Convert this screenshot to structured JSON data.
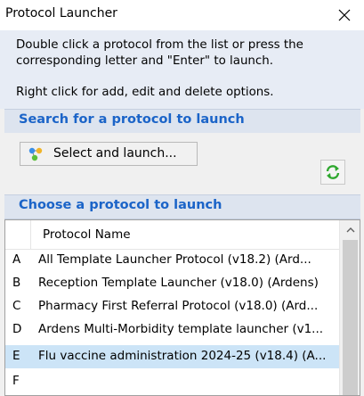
{
  "window": {
    "title": "Protocol Launcher",
    "close_icon": "close-icon"
  },
  "help": {
    "line1": "Double click a protocol from the list or press the",
    "line2": "corresponding letter and \"Enter\" to launch.",
    "line3": "Right click for add, edit and delete options."
  },
  "search_section": {
    "header": "Search for a protocol to launch",
    "button_label": "Select and launch...",
    "button_icon": "protocol-tree-icon",
    "refresh_icon": "refresh-icon"
  },
  "choose_section": {
    "header": "Choose a protocol to launch",
    "column_header": "Protocol Name",
    "rows": [
      {
        "key": "A",
        "name": "All Template Launcher Protocol (v18.2) (Ard...",
        "selected": false
      },
      {
        "key": "B",
        "name": "Reception Template Launcher (v18.0) (Ardens)",
        "selected": false
      },
      {
        "key": "C",
        "name": "Pharmacy First Referral Protocol (v18.0) (Ard...",
        "selected": false
      },
      {
        "key": "D",
        "name": "Ardens Multi-Morbidity template launcher (v1...",
        "selected": false
      },
      {
        "key": "E",
        "name": "Flu vaccine administration 2024-25 (v18.4) (A...",
        "selected": true
      },
      {
        "key": "F",
        "name": "",
        "selected": false
      }
    ]
  },
  "colors": {
    "section_header_text": "#1b64c8",
    "selection": "#cce4f7",
    "refresh_green": "#2fa82f"
  }
}
